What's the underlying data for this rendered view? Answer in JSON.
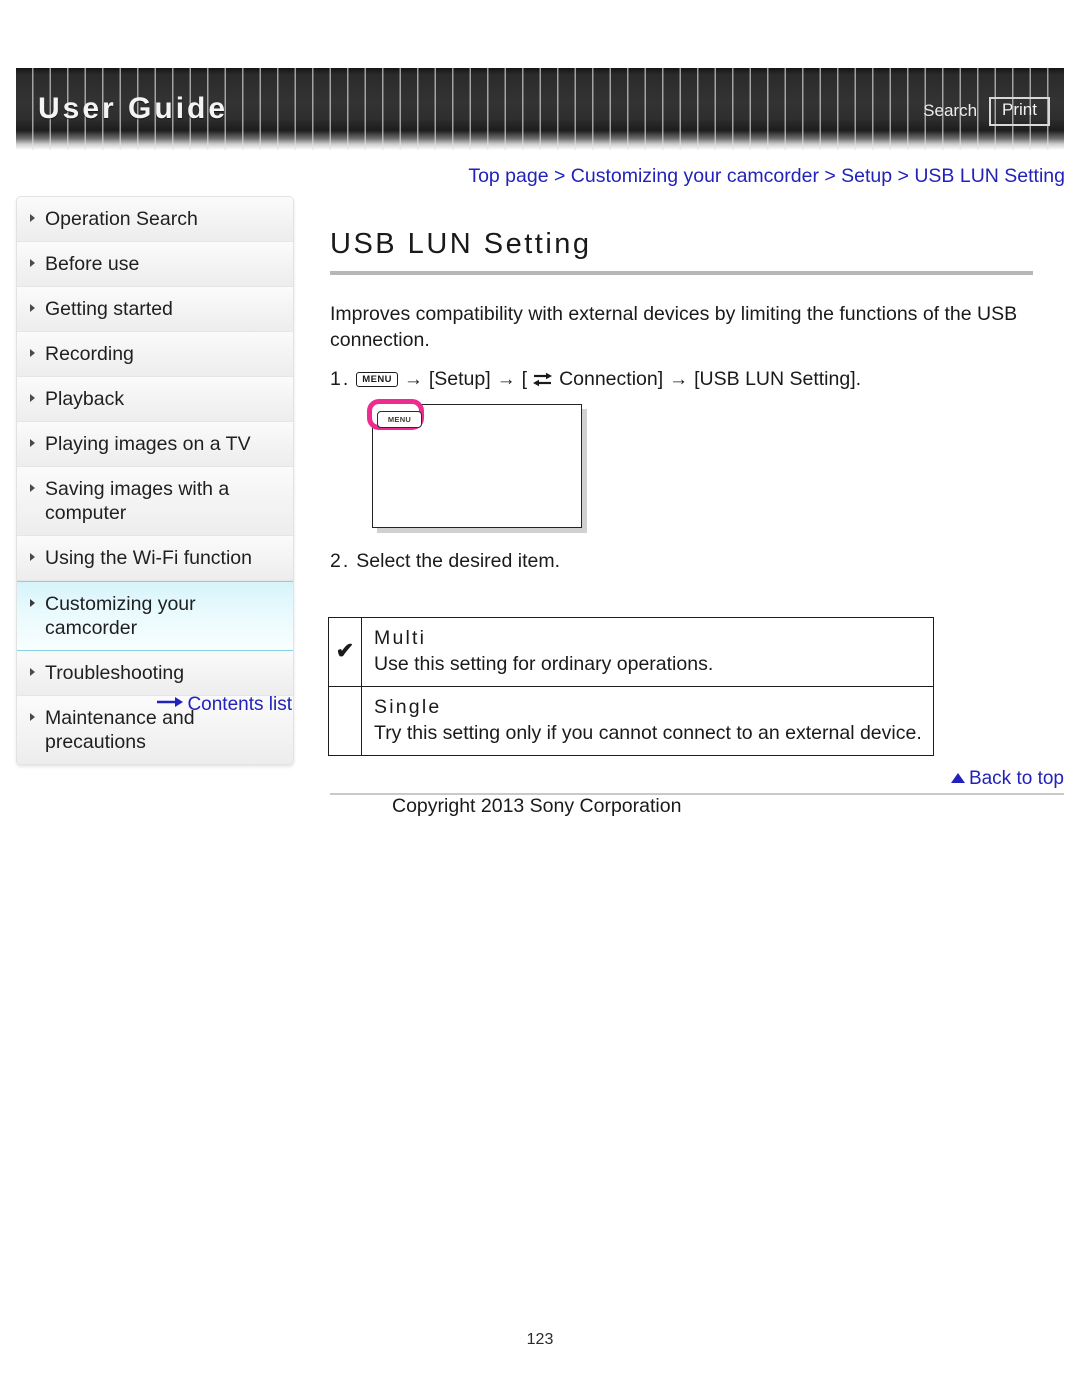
{
  "header": {
    "title": "User Guide",
    "search_label": "Search",
    "print_label": "Print"
  },
  "breadcrumb": {
    "text": "Top page > Customizing your camcorder > Setup > USB LUN Setting"
  },
  "sidebar": {
    "items": [
      {
        "label": "Operation Search",
        "active": false
      },
      {
        "label": "Before use",
        "active": false
      },
      {
        "label": "Getting started",
        "active": false
      },
      {
        "label": "Recording",
        "active": false
      },
      {
        "label": "Playback",
        "active": false
      },
      {
        "label": "Playing images on a TV",
        "active": false
      },
      {
        "label": "Saving images with a computer",
        "active": false
      },
      {
        "label": "Using the Wi-Fi function",
        "active": false
      },
      {
        "label": "Customizing your camcorder",
        "active": true
      },
      {
        "label": "Troubleshooting",
        "active": false
      },
      {
        "label": "Maintenance and precautions",
        "active": false
      }
    ],
    "contents_list_label": "Contents list"
  },
  "main": {
    "title": "USB LUN Setting",
    "intro": "Improves compatibility with external devices by limiting the functions of the USB connection.",
    "step1": {
      "number": "1.",
      "menu_chip": "MENU",
      "arrow": "→",
      "setup_label": "[Setup]",
      "connection_open": "[",
      "connection_label": "Connection]",
      "target_label": "[USB LUN Setting]."
    },
    "figure": {
      "menu_button_label": "MENU",
      "highlight_color": "#ee2b8e"
    },
    "step2": {
      "number": "2.",
      "text": "Select the desired item."
    },
    "options": [
      {
        "checked": "✔",
        "name": "Multi",
        "description": "Use this setting for ordinary operations."
      },
      {
        "checked": "",
        "name": "Single",
        "description": "Try this setting only if you cannot connect to an external device."
      }
    ]
  },
  "footer": {
    "back_to_top_label": "Back to top",
    "copyright": "Copyright 2013 Sony Corporation",
    "page_number": "123"
  }
}
